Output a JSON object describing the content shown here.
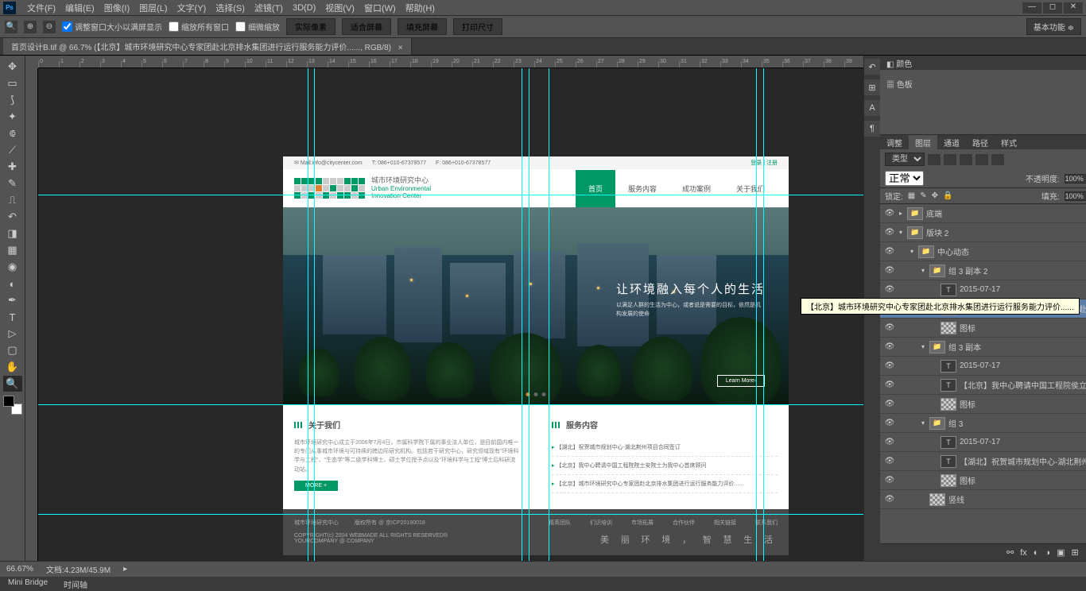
{
  "menubar": {
    "items": [
      "文件(F)",
      "编辑(E)",
      "图像(I)",
      "图层(L)",
      "文字(Y)",
      "选择(S)",
      "滤镜(T)",
      "3D(D)",
      "视图(V)",
      "窗口(W)",
      "帮助(H)"
    ]
  },
  "optionsbar": {
    "check1": "调整窗口大小以满屏显示",
    "check2": "缩放所有窗口",
    "check3": "细微缩放",
    "btn1": "实际像素",
    "btn2": "适合屏幕",
    "btn3": "填充屏幕",
    "btn4": "打印尺寸",
    "workspace": "基本功能"
  },
  "doctab": {
    "title": "首页设计B.tif @ 66.7% (【北京】城市环境研究中心专家团赴北京排水集团进行运行服务能力评价......, RGB/8)"
  },
  "website": {
    "topbar": {
      "mail": "Mail:info@citycenter.com",
      "tel": "T: 086+010-67378577",
      "fax": "F: 086+010-67378577",
      "login": "登录",
      "register": "注册"
    },
    "logo": {
      "cn": "城市环境研究中心",
      "en1": "Urban Environmental",
      "en2": "Innovation Center"
    },
    "nav": [
      "首页",
      "服务内容",
      "成功案例",
      "关于我们"
    ],
    "hero": {
      "title": "让环境融入每个人的生活",
      "sub1": "以满足人群的生活为中心，或者说是需要的目标，依然是机",
      "sub2": "构发展的使命",
      "learn": "Learn More›"
    },
    "about": {
      "title": "关于我们",
      "text": "城市环境研究中心成立于2006年7月4日，市属科学院下属的事业法人单位，是目前国内唯一的专门从事城市环境与可持续的跨边际研究机构。包括若干研究中心，研究领域现有\"环境科学与工程\"、\"生态学\"等二级学科博士、硕士学位授予点以及\"环境科学与工程\"博士后科研流动站。",
      "more": "MORE +"
    },
    "news": {
      "title": "服务内容",
      "items": [
        "【湖北】祝贺城市规划中心-湖北荆州项目合同签订",
        "【北京】我中心聘请中国工程院院士安院士为我中心首席顾问",
        "【北京】城市环境研究中心专家团赴北京排水集团进行运行服务能力评价......"
      ]
    },
    "footer": {
      "company": "城市环境研究中心",
      "rights": "版权所有 @ 京ICP20190018",
      "copyright": "COPYRIGHT(c) 2004 WEBMADE ALL RIGHTS RESERVED®",
      "your": "YOURCOMPANY @ COMPANY",
      "links": [
        "精英团队",
        "们识培训",
        "市场拓展",
        "合作伙伴",
        "相关链接",
        "联系我们"
      ],
      "slogan": "美 丽 环 境 ， 智 慧 生 活"
    }
  },
  "right": {
    "color_tab": "颜色",
    "swatch_tab": "色板",
    "adjust_tab": "调整"
  },
  "layers": {
    "tabs": [
      "图层",
      "通道",
      "路径",
      "样式"
    ],
    "kind": "类型",
    "blend": "正常",
    "opacity_label": "不透明度:",
    "opacity": "100%",
    "lock_label": "锁定:",
    "fill_label": "填充:",
    "fill": "100%",
    "rows": [
      {
        "indent": 0,
        "type": "folder",
        "name": "底端",
        "arrow": "▸"
      },
      {
        "indent": 0,
        "type": "folder",
        "name": "版块 2",
        "arrow": "▾"
      },
      {
        "indent": 1,
        "type": "folder",
        "name": "中心动态",
        "arrow": "▾"
      },
      {
        "indent": 2,
        "type": "folder",
        "name": "组 3 副本 2",
        "arrow": "▾"
      },
      {
        "indent": 3,
        "type": "text",
        "name": "2015-07-17"
      },
      {
        "indent": 3,
        "type": "text",
        "name": "【北京】城市环境研究中心专家团赴...",
        "selected": true
      },
      {
        "indent": 3,
        "type": "img",
        "name": "图标"
      },
      {
        "indent": 2,
        "type": "folder",
        "name": "组 3 副本",
        "arrow": "▾"
      },
      {
        "indent": 3,
        "type": "text",
        "name": "2015-07-17"
      },
      {
        "indent": 3,
        "type": "text",
        "name": "【北京】我中心聘请中国工程院侯立..."
      },
      {
        "indent": 3,
        "type": "img",
        "name": "图标"
      },
      {
        "indent": 2,
        "type": "folder",
        "name": "组 3",
        "arrow": "▾"
      },
      {
        "indent": 3,
        "type": "text",
        "name": "2015-07-17"
      },
      {
        "indent": 3,
        "type": "text",
        "name": "【湖北】祝贺城市规划中心-湖北荆州..."
      },
      {
        "indent": 3,
        "type": "img",
        "name": "图标"
      },
      {
        "indent": 2,
        "type": "img",
        "name": "竖线"
      }
    ],
    "tooltip": "【北京】城市环境研究中心专家团赴北京排水集团进行运行服务能力评价......"
  },
  "statusbar": {
    "zoom": "66.67%",
    "doc": "文档:4.23M/45.9M"
  },
  "bottom_tabs": [
    "Mini Bridge",
    "时间轴"
  ]
}
